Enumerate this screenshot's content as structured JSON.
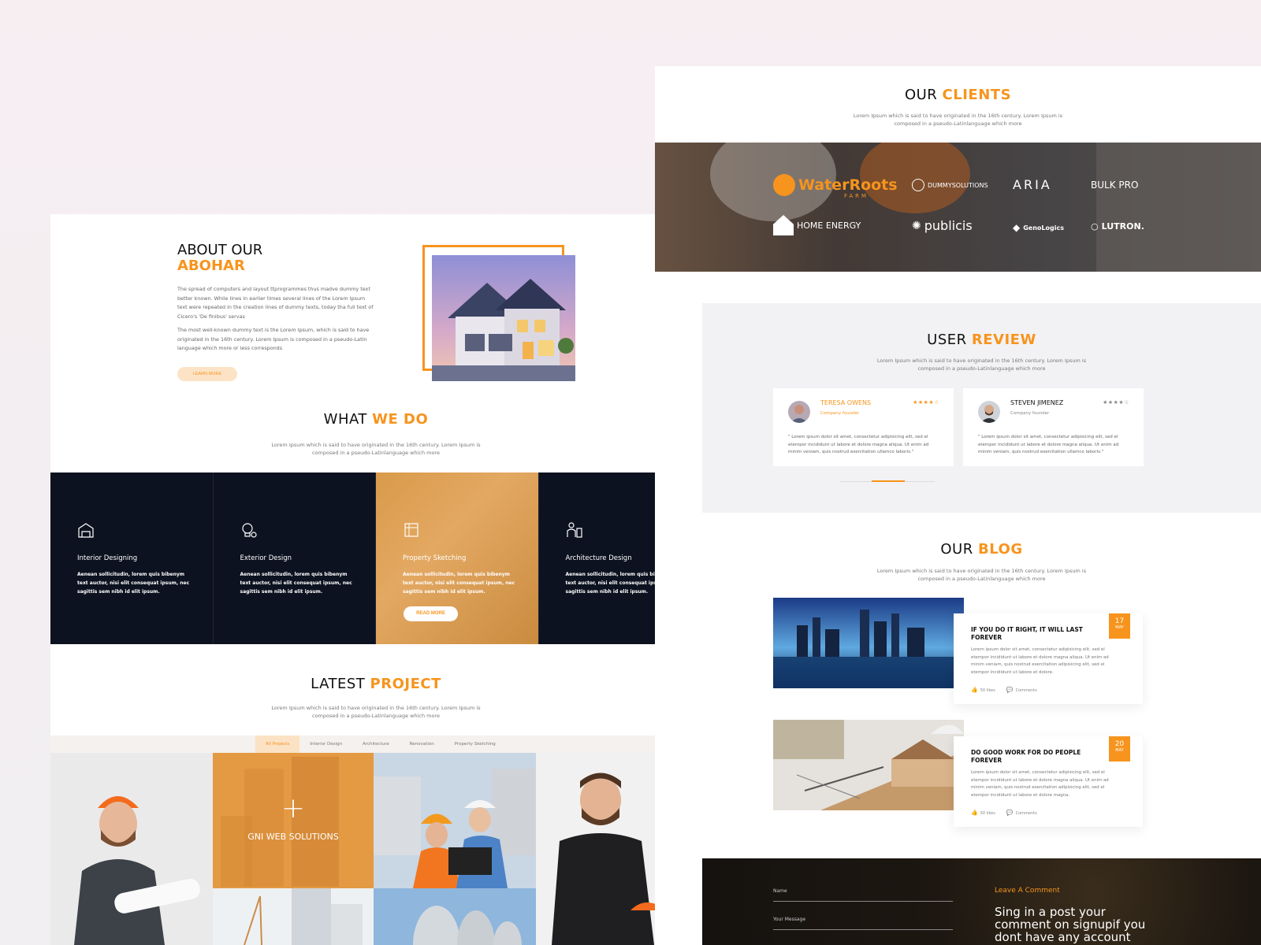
{
  "about": {
    "title_line1": "ABOUT OUR",
    "title_line2": "ABOHAR",
    "para1": "The spread of computers and layout ttprogrammes thus madve dummy text better known. While lines in earlier times several lines of the Lorem Ipsum text were repeated in the creation lines of dummy texts, today tha full text of Cicero's 'De finibus' servas",
    "para2": "The most well-known dummy text is the Lorem Ipsum, which is said to have originated in the 16th century. Lorem Ipsum is composed in a pseudo-Latin language which more or less corresponds",
    "button": "LEARN MORE"
  },
  "whatwedo": {
    "title_a": "WHAT ",
    "title_b": "WE DO",
    "sub1": "Lorem Ipsum which is said to have originated in the 16th century. Lorem Ipsum is",
    "sub2": "composed in a pseudo-Latinlanguage which more"
  },
  "services": [
    {
      "title": "Interior Designing",
      "desc": "Aenean sollicitudin, lorem quis bibenym text auctor, nisi elit consequat ipsum, nec sagittis sem nibh id elit ipsum.",
      "icon": "interior-icon"
    },
    {
      "title": "Exterior Design",
      "desc": "Aenean sollicitudin, lorem quis bibenym text auctor, nisi elit consequat ipsum, nec sagittis sem nibh id elit ipsum.",
      "icon": "bulb-icon"
    },
    {
      "title": "Property Sketching",
      "desc": "Aenean sollicitudin, lorem quis bibenym text auctor, nisi elit consequat ipsum, nec sagittis sem nibh id elit ipsum.",
      "icon": "sketch-icon",
      "button": "READ MORE"
    },
    {
      "title": "Architecture Design",
      "desc": "Aenean sollicitudin, lorem quis bibenym text auctor, nisi elit consequat ipsum, nec sagittis sem nibh id elit ipsum.",
      "icon": "architect-icon"
    }
  ],
  "latest": {
    "title_a": "LATEST ",
    "title_b": "PROJECT",
    "sub1": "Lorem Ipsum which is said to have originated in the 16th century. Lorem Ipsum is",
    "sub2": "composed in a pseudo-Latinlanguage which more",
    "tabs": [
      "All Projects",
      "Interior Design",
      "Architecture",
      "Renovation",
      "Property Sketching"
    ],
    "overlay_label": "GNI WEB SOLUTIONS"
  },
  "clients": {
    "title_a": "OUR ",
    "title_b": "CLIENTS",
    "sub1": "Lorem Ipsum which is said to have originated in the 16th century. Lorem Ipsum is",
    "sub2": "composed in a pseudo-Latinlanguage which more",
    "logos": [
      "WaterRoots",
      "FARM",
      "DUMMYSOLUTIONS",
      "ARIA",
      "BULK PRO",
      "HOME ENERGY",
      "publicis",
      "GenoLogics",
      "LUTRON."
    ]
  },
  "review": {
    "title_a": "USER ",
    "title_b": "REVIEW",
    "sub1": "Lorem Ipsum which is said to have originated in the 16th century. Lorem Ipsum is",
    "sub2": "composed in a pseudo-Latinlanguage which more",
    "cards": [
      {
        "name": "TERESA OWENS",
        "role": "Company founder",
        "stars": "★★★★☆",
        "text": "\" Lorem ipsum dolor sit amet, consectetur adipisicing elit, sed el etempor incididunt ut labore et dolore magna aliqua. Ut enim ad minim veniam, quis nostrud exercitation ullamco laboris.\""
      },
      {
        "name": "STEVEN JIMENEZ",
        "role": "Company founder",
        "stars": "★★★★☆",
        "text": "\" Lorem ipsum dolor sit amet, consectetur adipisicing elit, sed el etempor incididunt ut labore et dolore magna aliqua. Ut enim ad minim veniam, quis nostrud exercitation ullamco laboris.\""
      }
    ]
  },
  "blog": {
    "title_a": "OUR ",
    "title_b": "BLOG",
    "sub1": "Lorem Ipsum which is said to have originated in the 16th century. Lorem Ipsum is",
    "sub2": "composed in a pseudo-Latinlanguage which more",
    "posts": [
      {
        "title": "IF YOU DO IT RIGHT, IT WILL LAST FOREVER",
        "text": "Lorem ipsum dolor sit amet, consectetur adipisicing elit, sed el etempor incididunt ut labore et dolore magna aliqua. Ut enim ad minim veniam, quis nostrud exercitation adipisicing elit, sed el etempor incididunt ut labore et dolore.",
        "likes": "50 likes",
        "comments": "Comments",
        "day": "17",
        "month": "MAY"
      },
      {
        "title": "DO GOOD WORK FOR DO PEOPLE FOREVER",
        "text": "Lorem ipsum dolor sit amet, consectetur adipisicing elit, sed el etempor incididunt ut labore et dolore magna aliqua. Ut enim ad minim veniam, quis nostrud exercitation adipisicing elit, sed el etempor incididunt ut labore et dolore magna.",
        "likes": "50 likes",
        "comments": "Comments",
        "day": "20",
        "month": "MAY"
      }
    ]
  },
  "comment": {
    "name_label": "Name",
    "message_label": "Your Message",
    "title": "Leave A Comment",
    "text": "Sing in a post your comment on signupif you dont have any account"
  },
  "colors": {
    "accent": "#f7941d",
    "dark": "#0d1220"
  }
}
